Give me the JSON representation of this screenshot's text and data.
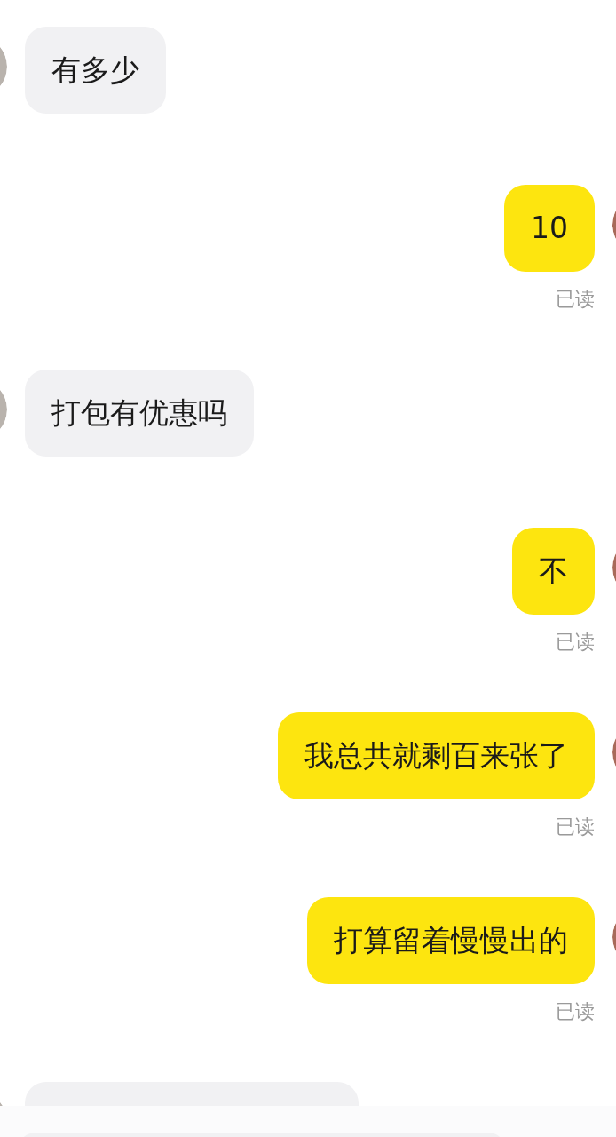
{
  "messages": [
    {
      "kind": "incoming",
      "text": "有多少"
    },
    {
      "kind": "outgoing",
      "text": "10",
      "receipt": "已读"
    },
    {
      "kind": "incoming",
      "text": "打包有优惠吗"
    },
    {
      "kind": "outgoing",
      "text": "不",
      "receipt": "已读"
    },
    {
      "kind": "outgoing",
      "text": "我总共就剩百来张了",
      "receipt": "已读"
    },
    {
      "kind": "outgoing",
      "text": "打算留着慢慢出的",
      "receipt": "已读"
    },
    {
      "kind": "incoming"
    }
  ]
}
